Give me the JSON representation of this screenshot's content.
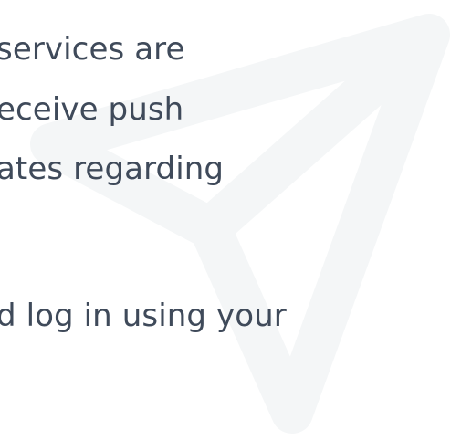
{
  "background": {
    "icon": "send-paper-plane-icon",
    "icon_color": "#f4f6f7"
  },
  "text": {
    "color": "#3f4a5a",
    "lines": [
      "services are",
      "eceive push",
      "ates regarding",
      "d log in using your"
    ]
  }
}
